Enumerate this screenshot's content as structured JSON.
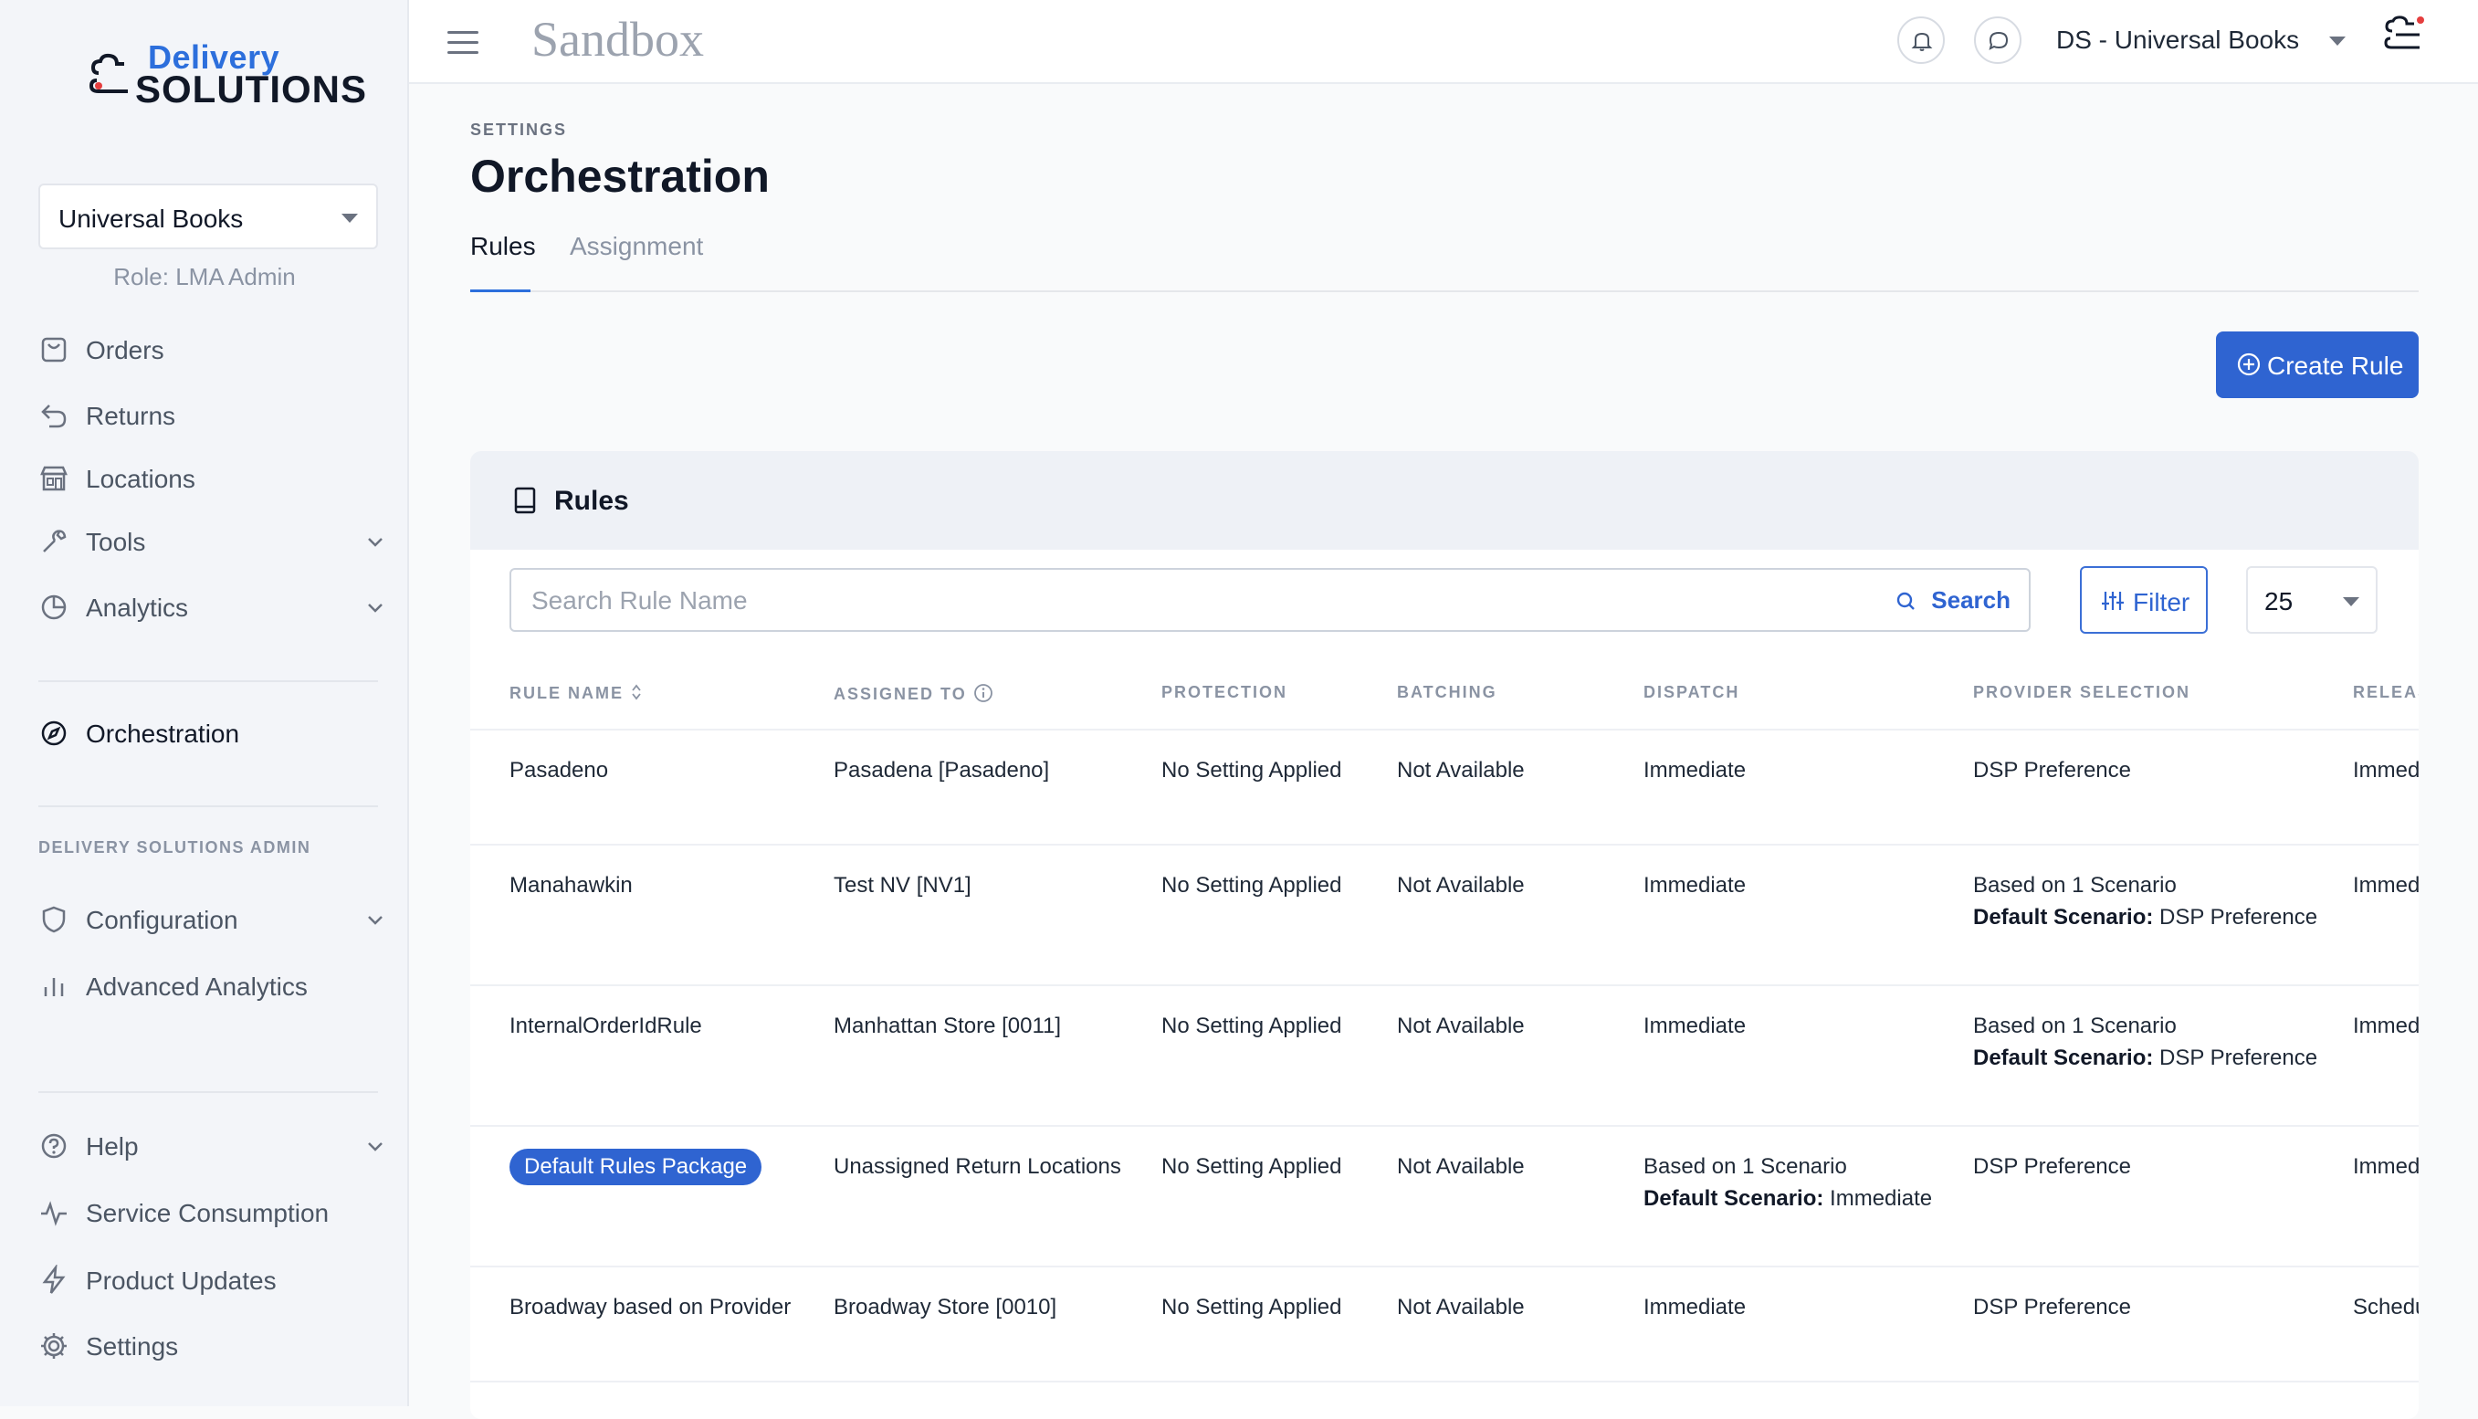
{
  "brand": {
    "name_top": "Delivery",
    "name_bottom": "SOLUTIONS"
  },
  "sidebar": {
    "account": "Universal Books",
    "role": "Role: LMA Admin",
    "items": [
      {
        "label": "Orders"
      },
      {
        "label": "Returns"
      },
      {
        "label": "Locations"
      },
      {
        "label": "Tools"
      },
      {
        "label": "Analytics"
      },
      {
        "label": "Orchestration"
      },
      {
        "label": "Configuration"
      },
      {
        "label": "Advanced Analytics"
      },
      {
        "label": "Help"
      },
      {
        "label": "Service Consumption"
      },
      {
        "label": "Product Updates"
      },
      {
        "label": "Settings"
      }
    ],
    "section_label": "DELIVERY SOLUTIONS ADMIN"
  },
  "topbar": {
    "environment": "Sandbox",
    "org": "DS - Universal Books"
  },
  "page": {
    "breadcrumb": "SETTINGS",
    "title": "Orchestration",
    "tabs": [
      {
        "label": "Rules"
      },
      {
        "label": "Assignment"
      }
    ],
    "create_label": "Create Rule"
  },
  "rules_card": {
    "title": "Rules",
    "search_placeholder": "Search Rule Name",
    "search_label": "Search",
    "filter_label": "Filter",
    "per_page": "25",
    "columns": [
      "RULE NAME",
      "ASSIGNED TO",
      "PROTECTION",
      "BATCHING",
      "DISPATCH",
      "PROVIDER SELECTION",
      "RELEAS"
    ],
    "rows": [
      {
        "name": "Pasadeno",
        "assigned": "Pasadena [Pasadeno]",
        "protection": "No Setting Applied",
        "batching": "Not Available",
        "dispatch": "Immediate",
        "provider": "DSP Preference",
        "release": "Immed"
      },
      {
        "name": "Manahawkin",
        "assigned": "Test NV [NV1]",
        "protection": "No Setting Applied",
        "batching": "Not Available",
        "dispatch": "Immediate",
        "provider": "Based on 1 Scenario",
        "provider_default_label": "Default Scenario:",
        "provider_default": " DSP Preference",
        "release": "Immed"
      },
      {
        "name": "InternalOrderIdRule",
        "assigned": "Manhattan Store [0011]",
        "protection": "No Setting Applied",
        "batching": "Not Available",
        "dispatch": "Immediate",
        "provider": "Based on 1 Scenario",
        "provider_default_label": "Default Scenario:",
        "provider_default": " DSP Preference",
        "release": "Immed"
      },
      {
        "name": "Default Rules Package",
        "assigned": "Unassigned Return Locations",
        "protection": "No Setting Applied",
        "batching": "Not Available",
        "dispatch": "Based on 1 Scenario",
        "dispatch_default_label": "Default Scenario:",
        "dispatch_default": " Immediate",
        "provider": "DSP Preference",
        "release": "Immed"
      },
      {
        "name": "Broadway based on Provider",
        "assigned": "Broadway Store [0010]",
        "protection": "No Setting Applied",
        "batching": "Not Available",
        "dispatch": "Immediate",
        "provider": "DSP Preference",
        "release": "Schedu"
      }
    ]
  },
  "colors": {
    "accent": "#2f64d1",
    "sidebar_bg": "#f3f5f9"
  }
}
